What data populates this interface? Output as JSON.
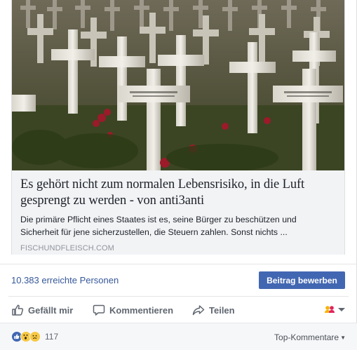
{
  "link_card": {
    "image": {
      "description_icon": "cemetery-photo"
    },
    "title": "Es gehört nicht zum normalen Lebensrisiko, in die Luft gesprengt zu werden - von anti3anti",
    "description": "Die primäre Pflicht eines Staates ist es, seine Bürger zu beschützen und Sicherheit für jene sicherzustellen, die Steuern zahlen. Sonst nichts ...",
    "source": "FISCHUNDFLEISCH.COM"
  },
  "reach": {
    "text": "10.383 erreichte Personen",
    "boost_label": "Beitrag bewerben"
  },
  "actions": {
    "like_label": "Gefällt mir",
    "comment_label": "Kommentieren",
    "share_label": "Teilen",
    "audience_icon": "audience-selector-icon"
  },
  "footer": {
    "reactions": [
      "like",
      "wow",
      "sad"
    ],
    "reaction_count": "117",
    "sort_label": "Top-Kommentare"
  },
  "colors": {
    "link_blue": "#365899",
    "button_blue": "#4267b2",
    "muted_text": "#606770",
    "card_bg": "#f2f3f5",
    "footer_bg": "#f6f7f9"
  }
}
